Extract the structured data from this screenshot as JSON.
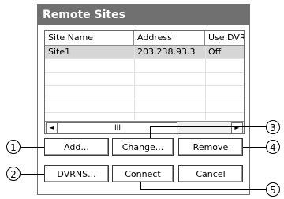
{
  "dialog": {
    "title": "Remote Sites"
  },
  "list": {
    "columns": [
      "Site Name",
      "Address",
      "Use DVR"
    ],
    "rows": [
      {
        "name": "Site1",
        "address": "203.238.93.3",
        "use_dvr": "Off"
      }
    ]
  },
  "scrollbar": {
    "left_arrow": "◄",
    "thumb_grip": "III",
    "right_arrow": "►"
  },
  "buttons": {
    "add": "Add...",
    "change": "Change...",
    "remove": "Remove",
    "dvrns": "DVRNS...",
    "connect": "Connect",
    "cancel": "Cancel"
  },
  "callouts": {
    "one": "1",
    "two": "2",
    "three": "3",
    "four": "4",
    "five": "5"
  }
}
